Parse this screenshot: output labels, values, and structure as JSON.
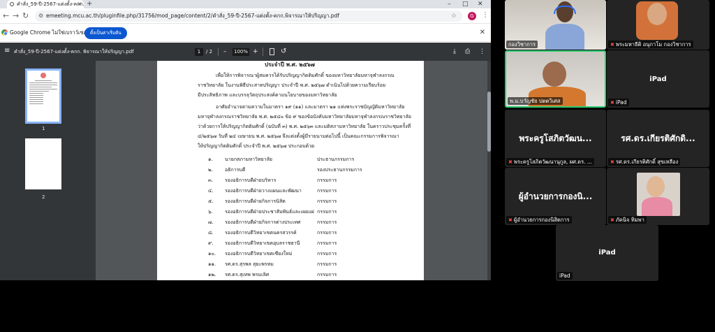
{
  "browser": {
    "tab_title": "คำสั่ง_59-ปี-2567-แต่งตั้ง-คกก.พิ…",
    "url": "emeeting.mcu.ac.th/pluginfile.php/31756/mod_page/content/2/คำสั่ง_59-ปี-2567-แต่งตั้ง-คกก.พิจารณาให้ปริญญา.pdf",
    "profile_initial": "G",
    "infobar_text": "Google Chrome ไม่ใช่เบราว์เซอร์ที่ตั้งค่าไว้",
    "infobar_button": "ตั้งเป็นค่าเริ่มต้น"
  },
  "pdf": {
    "title": "คำสั่ง_59-ปี-2567-แต่งตั้ง-คกก. พิจารณาให้ปริญญา.pdf",
    "page_current": "1",
    "page_total": "/ 2",
    "zoom": "100%",
    "thumb_labels": [
      "1",
      "2"
    ],
    "page_heading": "ประจำปี พ.ศ. ๒๕๖๗",
    "paragraphs": [
      "เพื่อให้การพิจารณาผู้สมควรได้รับปริญญากิตติมศักดิ์ ของมหาวิทยาลัยมหาจุฬาลงกรณ",
      "ราชวิทยาลัย ในงานพิธีประสาทปริญญา ประจำปี พ.ศ. ๒๕๖๗ ดำเนินไปด้วยความเรียบร้อย",
      "มีประสิทธิภาพ และบรรลุวัตถุประสงค์ตามนโยบายของมหาวิทยาลัย",
      "อาศัยอำนาจตามความในมาตรา ๑๙ (๑๑) และมาตรา ๒๑ แห่งพระราชบัญญัติมหาวิทยาลัย",
      "มหาจุฬาลงกรณราชวิทยาลัย พ.ศ. ๒๕๔๐ ข้อ ๙ ของข้อบังคับมหาวิทยาลัยมหาจุฬาลงกรณราชวิทยาลัย",
      "ว่าด้วยการให้ปริญญากิตติมศักดิ์ (ฉบับที่ ๓) พ.ศ. ๒๕๖๓ และมติสภามหาวิทยาลัย ในคราวประชุมครั้งที่",
      "๔/๒๕๖๗ วันที่ ๒๔ เมษายน พ.ศ. ๒๕๖๗ จึงแต่งตั้งผู้มีรายนามต่อไปนี้ เป็นคณะกรรมการพิจารณา",
      "ให้ปริญญากิตติมศักดิ์ ประจำปี พ.ศ. ๒๕๖๗ ประกอบด้วย"
    ],
    "members": [
      {
        "no": "๑.",
        "name": "นายกสภามหาวิทยาลัย",
        "role": "ประธานกรรมการ"
      },
      {
        "no": "๒.",
        "name": "อธิการบดี",
        "role": "รองประธานกรรมการ"
      },
      {
        "no": "๓.",
        "name": "รองอธิการบดีฝ่ายบริหาร",
        "role": "กรรมการ"
      },
      {
        "no": "๔.",
        "name": "รองอธิการบดีฝ่ายวางแผนและพัฒนา",
        "role": "กรรมการ"
      },
      {
        "no": "๕.",
        "name": "รองอธิการบดีฝ่ายกิจการนิสิต",
        "role": "กรรมการ"
      },
      {
        "no": "๖.",
        "name": "รองอธิการบดีฝ่ายประชาสัมพันธ์และเผยแผ่",
        "role": "กรรมการ"
      },
      {
        "no": "๗.",
        "name": "รองอธิการบดีฝ่ายกิจการต่างประเทศ",
        "role": "กรรมการ"
      },
      {
        "no": "๘.",
        "name": "รองอธิการบดีวิทยาเขตนครสวรรค์",
        "role": "กรรมการ"
      },
      {
        "no": "๙.",
        "name": "รองอธิการบดีวิทยาเขตอุบลราชธานี",
        "role": "กรรมการ"
      },
      {
        "no": "๑๐.",
        "name": "รองอธิการบดีวิทยาเขตเชียงใหม่",
        "role": "กรรมการ"
      },
      {
        "no": "๑๑.",
        "name": "รศ.ดร.สุรพล สุยะพรหม",
        "role": "กรรมการ"
      },
      {
        "no": "๑๒.",
        "name": "รศ.ดร.สุเทพ พรมเลิศ",
        "role": "กรรมการ"
      }
    ]
  },
  "meeting": {
    "tiles": [
      {
        "label": "กองวิชาการ",
        "muted": false
      },
      {
        "label": "พระมหาธีติ อนุกาโม กองวิชาการ",
        "muted": true
      },
      {
        "label": "พ.ม.บาํญชัย ปตตวิเศส",
        "muted": false
      },
      {
        "label": "iPad",
        "muted": true,
        "center_name": "iPad"
      },
      {
        "label": "พระครูโสภิตวัฒนานุกูล, ผศ.ดร. ...",
        "muted": true,
        "center_name": "พระครูโสภิตวัฒน..."
      },
      {
        "label": "รศ.ดร.เกียรติศักดิ์ สุขเหลือง",
        "muted": true,
        "center_name": "รศ.ดร.เกียรติศักดิ..."
      },
      {
        "label": "ผู้อำนวยการกองนิสิตการ",
        "muted": true,
        "center_name": "ผู้อำนวยการกองนิ..."
      },
      {
        "label": "ภัคนิจ ทิมพา",
        "muted": true
      },
      {
        "label": "iPad",
        "muted": false,
        "center_name": "iPad"
      }
    ],
    "colors": {
      "tile_bg": "#242424",
      "active_border": "#2ecc71",
      "mic_off": "#ff4d4d"
    }
  }
}
